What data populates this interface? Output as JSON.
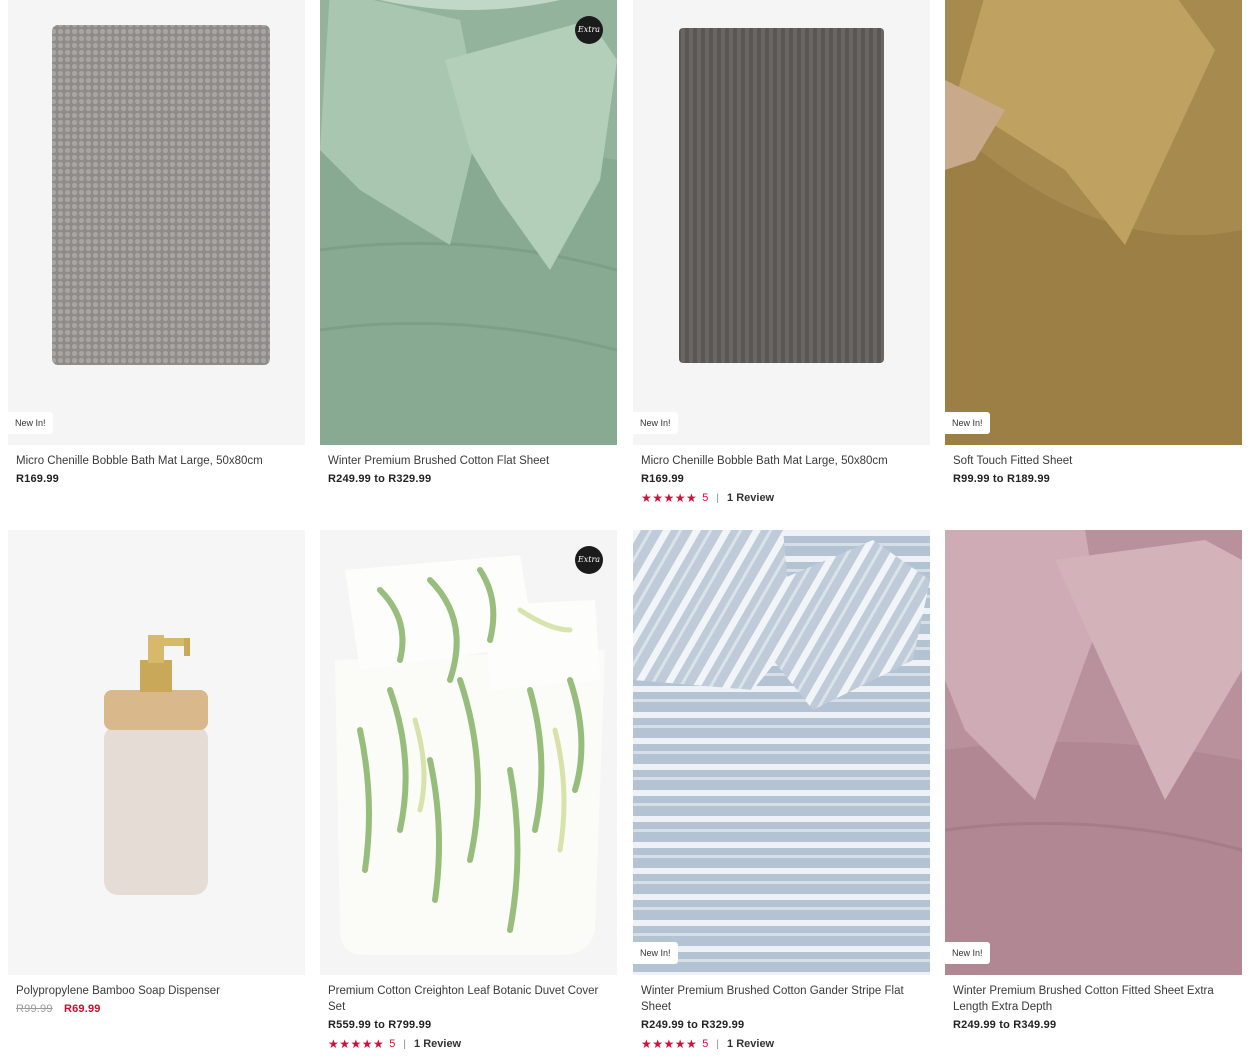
{
  "products": [
    {
      "title": "Micro Chenille Bobble Bath Mat Large, 50x80cm",
      "price": "R169.99",
      "badge": "New In!",
      "image": "grey-bobble-bath-mat"
    },
    {
      "title": "Winter Premium Brushed Cotton Flat Sheet",
      "price": "R249.99 to R329.99",
      "badge_extra": "Extra",
      "image": "sage-green-sheet-pillows"
    },
    {
      "title": "Micro Chenille Bobble Bath Mat Large, 50x80cm",
      "price": "R169.99",
      "badge": "New In!",
      "image": "charcoal-bath-mat",
      "stars": "★★★★★",
      "rating": "5",
      "separator": "|",
      "reviews": "1 Review"
    },
    {
      "title": "Soft Touch Fitted Sheet",
      "price": "R99.99 to R189.99",
      "badge": "New In!",
      "image": "mustard-sheet-pillow"
    },
    {
      "title": "Polypropylene Bamboo Soap Dispenser",
      "price_was": "R99.99",
      "price_now": "R69.99",
      "image": "bamboo-soap-dispenser"
    },
    {
      "title": "Premium Cotton Creighton Leaf Botanic Duvet Cover Set",
      "price": "R559.99 to R799.99",
      "badge_extra": "Extra",
      "image": "botanic-leaf-duvet",
      "stars": "★★★★★",
      "rating": "5",
      "separator": "|",
      "reviews": "1 Review"
    },
    {
      "title": "Winter Premium Brushed Cotton Gander Stripe Flat Sheet",
      "price": "R249.99 to R329.99",
      "badge": "New In!",
      "image": "blue-stripe-sheet",
      "stars": "★★★★★",
      "rating": "5",
      "separator": "|",
      "reviews": "1 Review"
    },
    {
      "title": "Winter Premium Brushed Cotton Fitted Sheet Extra Length Extra Depth",
      "price": "R249.99 to R349.99",
      "badge": "New In!",
      "image": "dusty-pink-sheet-pillows"
    }
  ],
  "colors": {
    "accent": "#c8102e",
    "star": "#d0103a"
  }
}
